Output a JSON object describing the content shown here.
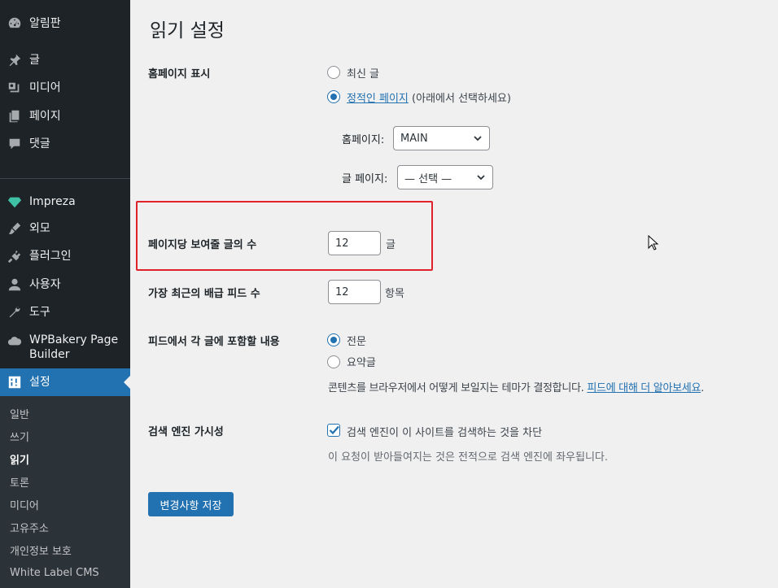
{
  "sidebar": {
    "items": [
      {
        "label": "알림판",
        "icon": "dashboard-icon"
      },
      {
        "label": "글",
        "icon": "pin-icon"
      },
      {
        "label": "미디어",
        "icon": "media-icon"
      },
      {
        "label": "페이지",
        "icon": "page-icon"
      },
      {
        "label": "댓글",
        "icon": "comment-icon"
      },
      {
        "label": "Impreza",
        "icon": "diamond-icon"
      },
      {
        "label": "외모",
        "icon": "brush-icon"
      },
      {
        "label": "플러그인",
        "icon": "plugin-icon"
      },
      {
        "label": "사용자",
        "icon": "user-icon"
      },
      {
        "label": "도구",
        "icon": "wrench-icon"
      },
      {
        "label": "WPBakery Page Builder",
        "icon": "cloud-icon"
      },
      {
        "label": "설정",
        "icon": "settings-icon"
      }
    ],
    "submenu": [
      "일반",
      "쓰기",
      "읽기",
      "토론",
      "미디어",
      "고유주소",
      "개인정보 보호",
      "White Label CMS"
    ],
    "active_submenu": "읽기"
  },
  "page": {
    "title": "읽기 설정",
    "homepage_display": {
      "label": "홈페이지 표시",
      "option_latest": "최신 글",
      "option_static_link": "정적인 페이지",
      "option_static_suffix": "(아래에서 선택하세요)",
      "selected": "static",
      "homepage_label": "홈페이지:",
      "homepage_value": "MAIN",
      "posts_page_label": "글 페이지:",
      "posts_page_value": "— 선택 —"
    },
    "posts_per_page": {
      "label": "페이지당 보여줄 글의 수",
      "value": "12",
      "unit": "글"
    },
    "feed_count": {
      "label": "가장 최근의 배급 피드 수",
      "value": "12",
      "unit": "항목"
    },
    "feed_content": {
      "label": "피드에서 각 글에 포함할 내용",
      "option_full": "전문",
      "option_excerpt": "요약글",
      "selected": "full",
      "desc_prefix": "콘텐츠를 브라우저에서 어떻게 보일지는 테마가 결정합니다.",
      "desc_link": "피드에 대해 더 알아보세요",
      "desc_suffix": "."
    },
    "search_visibility": {
      "label": "검색 엔진 가시성",
      "checkbox_label": "검색 엔진이 이 사이트를 검색하는 것을 차단",
      "checked": true,
      "note": "이 요청이 받아들여지는 것은 전적으로 검색 엔진에 좌우됩니다."
    },
    "save_button": "변경사항 저장"
  },
  "colors": {
    "accent": "#2271b1",
    "sidebar": "#1d2327",
    "highlight": "#e0202a"
  }
}
